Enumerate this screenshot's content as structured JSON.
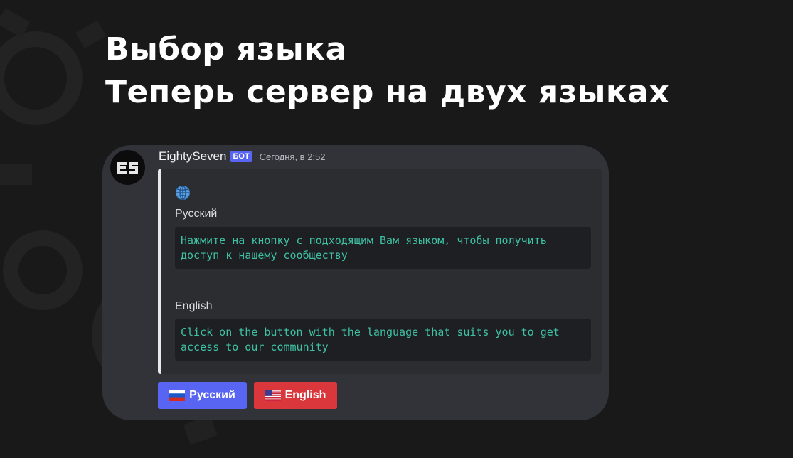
{
  "headline": {
    "line1": "Выбор языка",
    "line2": "Теперь сервер на двух языках"
  },
  "message": {
    "author": "EightySeven",
    "badge": "БОТ",
    "timestamp": "Сегодня, в 2:52",
    "avatar_text": "ES"
  },
  "embed": {
    "icon": "globe-icon",
    "fields": [
      {
        "name": "Русский",
        "value": "Нажмите на кнопку с подходящим Вам языком, чтобы получить доступ к нашему сообществу"
      },
      {
        "name": "English",
        "value": "Click on the button with the language that suits you to get access to our community"
      }
    ]
  },
  "buttons": [
    {
      "label": "Русский",
      "icon": "russia-flag-icon",
      "color": "#5865f2"
    },
    {
      "label": "English",
      "icon": "us-flag-icon",
      "color": "#da373c"
    }
  ],
  "colors": {
    "background": "#191919",
    "card": "#313338",
    "embed": "#2b2d31",
    "code_text": "#3ec1a4",
    "blurple": "#5865f2",
    "red": "#da373c"
  }
}
